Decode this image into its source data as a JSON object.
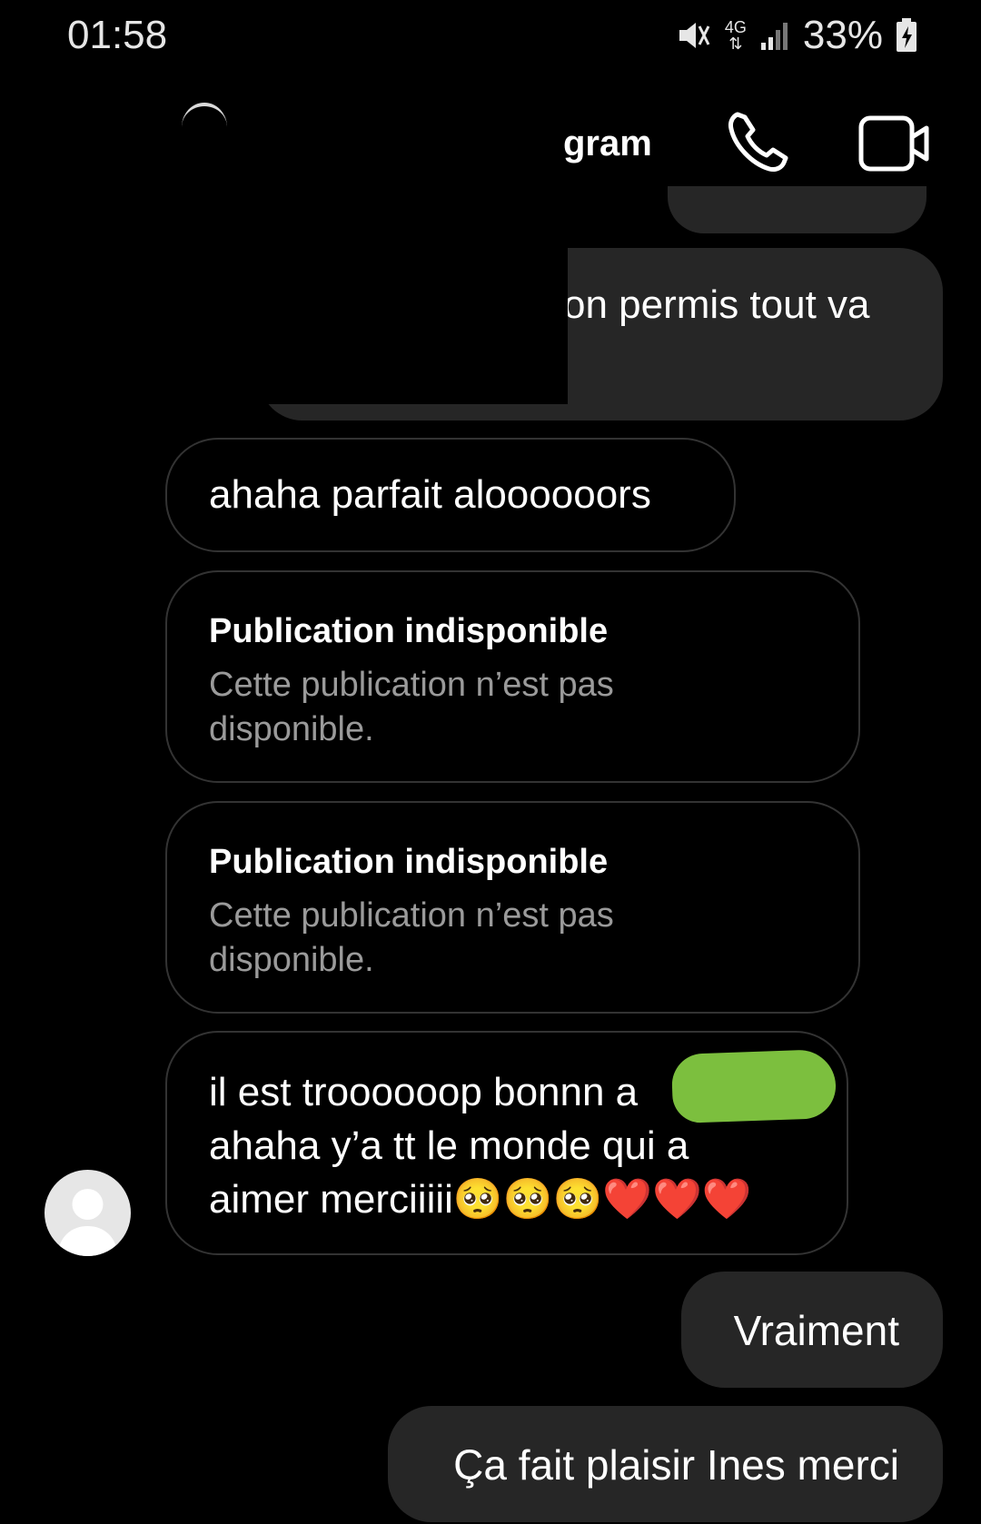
{
  "status_bar": {
    "time": "01:58",
    "network": "4G",
    "battery": "33%",
    "icons": [
      "mute-icon",
      "network-4g-icon",
      "signal-icon",
      "battery-charging-icon"
    ]
  },
  "header": {
    "title": "gram",
    "call_icon": "phone-icon",
    "video_icon": "video-camera-icon"
  },
  "messages": [
    {
      "direction": "sent",
      "text": "on permis tout va"
    },
    {
      "direction": "received",
      "text": "ahaha parfait aloooooors"
    },
    {
      "direction": "received",
      "type": "post",
      "title": "Publication indisponible",
      "desc": "Cette publication n’est pas disponible."
    },
    {
      "direction": "received",
      "type": "post",
      "title": "Publication indisponible",
      "desc": "Cette publication n’est pas disponible."
    },
    {
      "direction": "received",
      "lines": [
        "il est troooooop bonnn a",
        "ahaha y’a tt le monde qui a",
        "aimer merciiiii🥺🥺🥺❤️❤️❤️"
      ]
    },
    {
      "direction": "sent",
      "text": "Vraiment"
    },
    {
      "direction": "sent",
      "text": "Ça fait plaisir Ines merci"
    }
  ],
  "colors": {
    "background": "#000000",
    "sent_bubble": "#262626",
    "received_border": "#333333",
    "muted_text": "#9a9a9a",
    "scribble": "#7cbf3e"
  }
}
